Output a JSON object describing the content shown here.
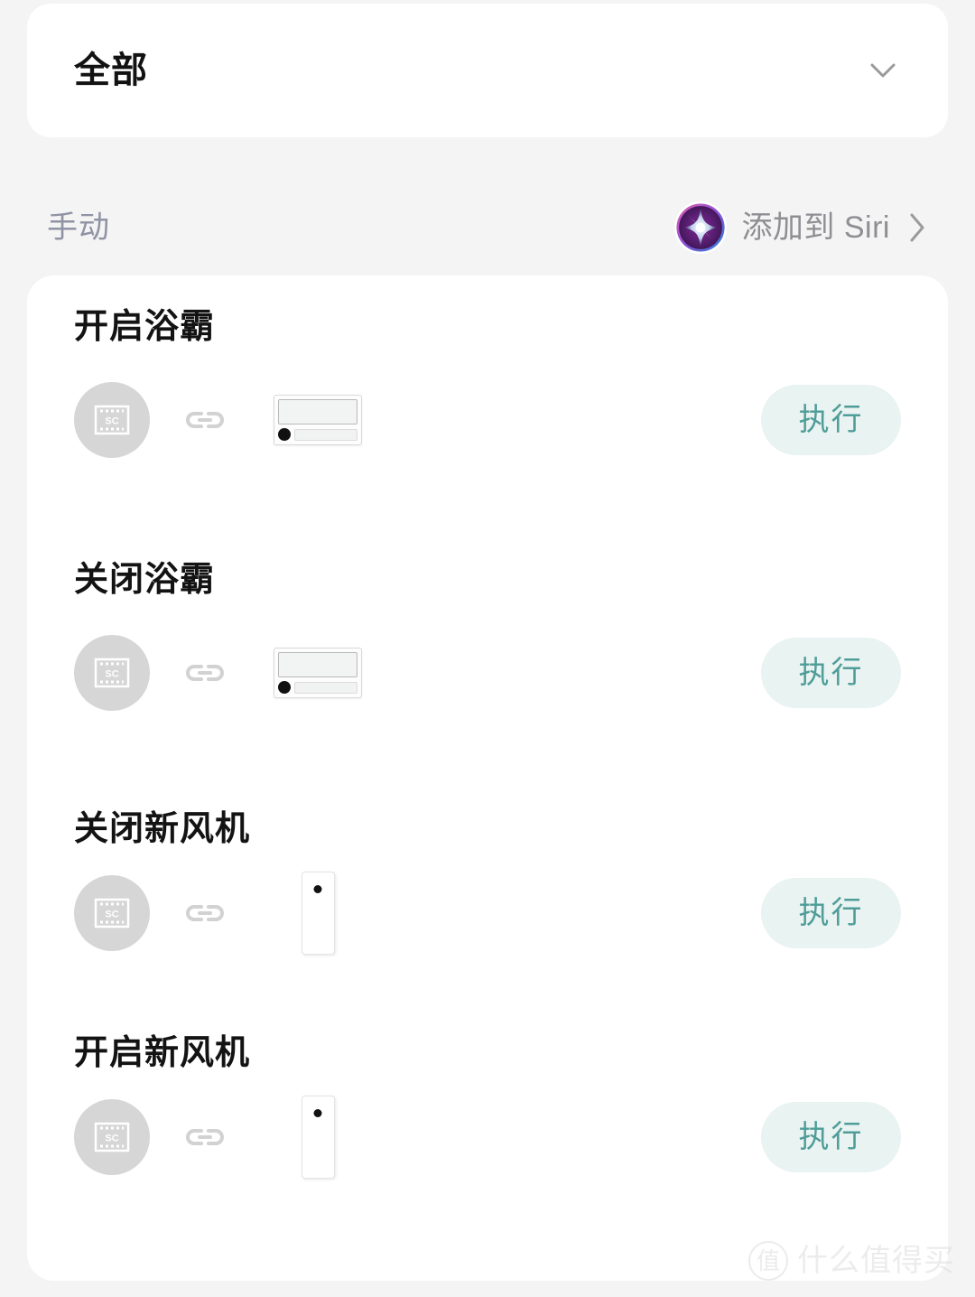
{
  "filter": {
    "label": "全部",
    "chevron_icon": "chevron-down-icon"
  },
  "section": {
    "label": "手动",
    "siri": {
      "icon": "siri-orb-icon",
      "label": "添加到 Siri",
      "chevron_icon": "chevron-right-icon"
    }
  },
  "scenes": [
    {
      "title": "开启浴霸",
      "source_icon": "sc-chip-icon",
      "link_icon": "link-icon",
      "device_icon": "bath-heater-device",
      "action_label": "执行"
    },
    {
      "title": "关闭浴霸",
      "source_icon": "sc-chip-icon",
      "link_icon": "link-icon",
      "device_icon": "bath-heater-device",
      "action_label": "执行"
    },
    {
      "title": "关闭新风机",
      "source_icon": "sc-chip-icon",
      "link_icon": "link-icon",
      "device_icon": "fresh-air-device",
      "action_label": "执行"
    },
    {
      "title": "开启新风机",
      "source_icon": "sc-chip-icon",
      "link_icon": "link-icon",
      "device_icon": "fresh-air-device",
      "action_label": "执行"
    }
  ],
  "watermark": {
    "badge": "值",
    "text": "什么值得买"
  },
  "colors": {
    "page_background": "#f4f4f5",
    "card_background": "#ffffff",
    "title_text": "#131313",
    "muted_text": "#8f93a3",
    "siri_text": "#8e8e93",
    "action_button_background": "#e9f3f2",
    "action_button_text": "#4f9d98",
    "avatar_background": "#d6d6d6"
  }
}
